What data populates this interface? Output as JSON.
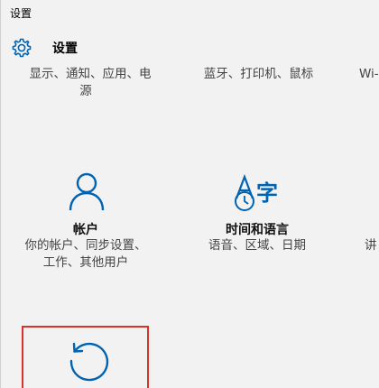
{
  "window": {
    "title": "设置"
  },
  "header": {
    "title": "设置",
    "icon": "gear-icon"
  },
  "top_row": {
    "system_desc_line1": "显示、通知、应用、电",
    "system_desc_line2": "源",
    "devices_desc": "蓝牙、打印机、鼠标",
    "network_desc": "Wi-"
  },
  "tiles": {
    "accounts": {
      "name": "帐户",
      "desc_line1": "你的帐户、同步设置、",
      "desc_line2": "工作、其他用户",
      "icon": "person-icon"
    },
    "time_language": {
      "name": "时间和语言",
      "desc_line1": "语音、区域、日期",
      "icon": "time-language-icon"
    },
    "ease": {
      "desc_line1": "讲"
    },
    "update": {
      "icon": "update-icon"
    }
  },
  "colors": {
    "accent": "#0063b1",
    "highlight": "#d9322b"
  }
}
